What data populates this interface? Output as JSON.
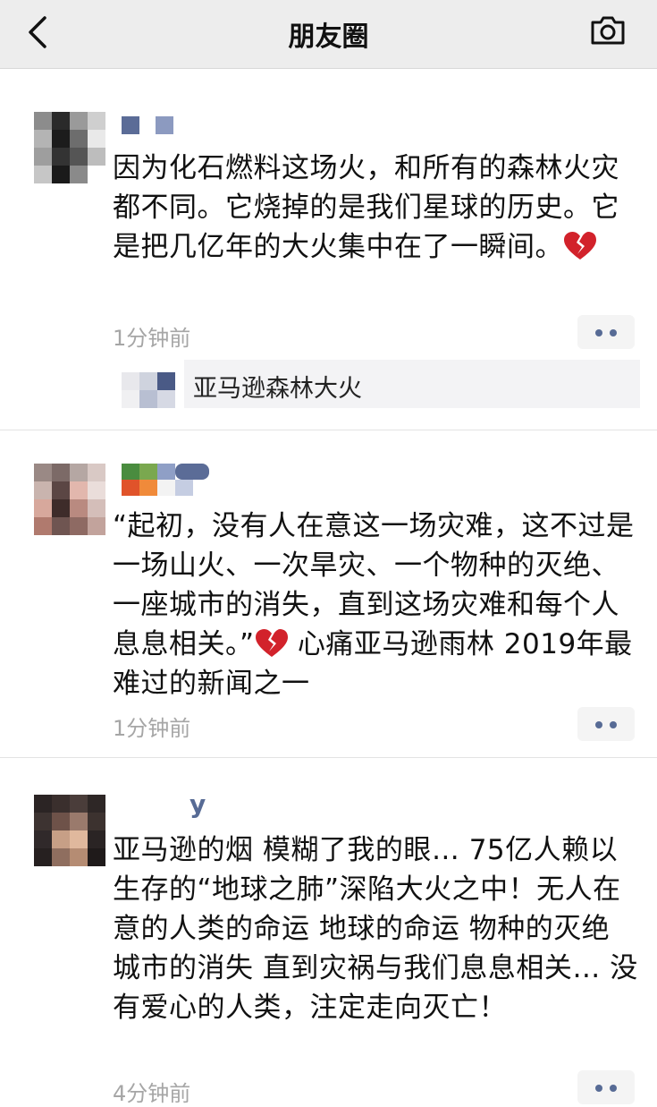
{
  "navbar": {
    "title": "朋友圈",
    "back_icon": "chevron-left-icon",
    "camera_icon": "camera-icon"
  },
  "posts": [
    {
      "nickname": "",
      "content": "因为化石燃料这场火，和所有的森林火灾都不同。它烧掉的是我们星球的历史。它是把几亿年的大火集中在了一瞬间。",
      "emoji": "broken-heart-icon",
      "time": "1分钟前",
      "link": {
        "title": "亚马逊森林大火"
      }
    },
    {
      "nickname": "",
      "content_before": "“起初，没有人在意这一场灾难，这不过是一场山火、一次旱灾、一个物种的灭绝、一座城市的消失，直到这场灾难和每个人息息相关。”",
      "content_after": " 心痛亚马逊雨林 2019年最难过的新闻之一",
      "emoji": "broken-heart-icon",
      "time": "1分钟前"
    },
    {
      "nickname": "y",
      "content": "亚马逊的烟 模糊了我的眼… 75亿人赖以生存的“地球之肺”深陷大火之中！无人在意的人类的命运 地球的命运 物种的灭绝 城市的消失 直到灾祸与我们息息相关… 没有爱心的人类，注定走向灭亡！",
      "time": "4分钟前"
    }
  ],
  "colors": {
    "nav_bg": "#ededed",
    "nickname": "#576b95",
    "time": "#a6a6a6",
    "more_btn_bg": "#f4f4f4",
    "link_bg": "#f3f3f5",
    "heart": "#d2222b"
  }
}
